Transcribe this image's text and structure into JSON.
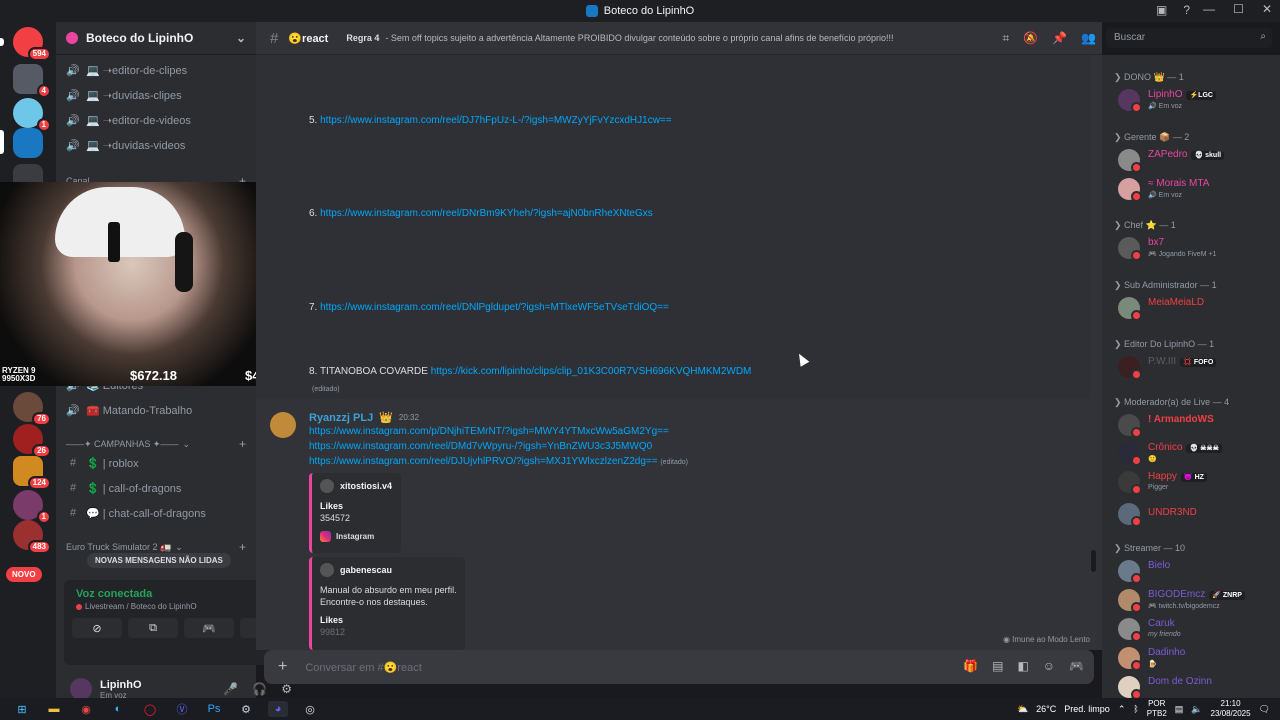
{
  "window": {
    "title": "Boteco do LipinhO",
    "minimize": "—",
    "maximize": "☐",
    "close": "✕"
  },
  "guilds": [
    {
      "badge": "594",
      "color": "#f23f43"
    },
    {
      "badge": "4",
      "color": "#555a64"
    },
    {
      "badge": "1",
      "color": "#6ec6e8"
    },
    {
      "badge": "",
      "color": "#1a78c2"
    },
    {
      "badge": "",
      "color": "#3a3c41"
    },
    {
      "badge": "76",
      "color": "#6a4a3a"
    },
    {
      "badge": "26",
      "color": "#a02020"
    },
    {
      "badge": "124",
      "color": "#d08a20"
    },
    {
      "badge": "1",
      "color": "#7a3a6a"
    },
    {
      "badge": "483",
      "color": "#9a3030"
    }
  ],
  "novo_label": "NOVO",
  "server": {
    "name": "Boteco do LipinhO"
  },
  "channels_top": [
    {
      "label": "💻 ➝editor-de-clipes"
    },
    {
      "label": "💻 ➝duvidas-clipes"
    },
    {
      "label": "💻 ➝editor-de-videos"
    },
    {
      "label": "💻 ➝duvidas-videos"
    }
  ],
  "category_canal": "Canal",
  "channels_mid": [
    {
      "label": "📚 Editores"
    },
    {
      "label": "🧰 Matando-Trabalho"
    }
  ],
  "category_campanhas": "——✦ CAMPANHAS ✦——",
  "channels_campanhas": [
    {
      "icon": "#",
      "label": "💲 | roblox"
    },
    {
      "icon": "#",
      "label": "💲 | call-of-dragons"
    },
    {
      "icon": "#",
      "label": "💬 | chat-call-of-dragons"
    }
  ],
  "category_euro": "Euro Truck Simulator 2 🚛",
  "unread_label": "NOVAS MENSAGENS NÃO LIDAS",
  "voice": {
    "status": "Voz conectada",
    "channel": "Livestream / Boteco do LipinhO"
  },
  "user": {
    "name": "LipinhO",
    "status": "Em voz"
  },
  "webcam": {
    "cpu": "RYZEN 9\n9950X3D",
    "price1": "$672.18",
    "price2": "$4,500"
  },
  "channel": {
    "name": "😮react",
    "topic_bold": "Regra 4",
    "topic": "- Sem off topics sujeito a advertência Altamente PROIBIDO divulgar conteúdo sobre o próprio canal afins de benefício próprio!!!"
  },
  "search": {
    "placeholder": "Buscar"
  },
  "messages": {
    "m5": {
      "num": "5.",
      "link": "https://www.instagram.com/reel/DJ7hFpUz-L-/?igsh=MWZyYjFvYzcxdHJ1cw=="
    },
    "m6": {
      "num": "6.",
      "link": "https://www.instagram.com/reel/DNrBm9KYheh/?igsh=ajN0bnRheXNteGxs"
    },
    "m7": {
      "num": "7.",
      "link": "https://www.instagram.com/reel/DNlPgldupet/?igsh=MTlxeWF5eTVseTdiOQ=="
    },
    "m8": {
      "text": "8. TITANOBOA COVARDE",
      "link": "https://kick.com/lipinho/clips/clip_01K3C00R7VSH696KVQHMKM2WDM"
    },
    "edited": "(editado)",
    "author": "Ryanzzj PLJ",
    "author_badge": "👑",
    "time": "20:32",
    "links": [
      "https://www.instagram.com/p/DNjhiTEMrNT/?igsh=MWY4YTMxcWw5aGM2Yg==",
      "https://www.instagram.com/reel/DMd7vWpyru-/?igsh=YnBnZWU3c3J5MWQ0",
      "https://www.instagram.com/reel/DJUjvhlPRVO/?igsh=MXJ1YWlxczlzenZ2dg=="
    ],
    "embed1": {
      "author": "xitostiosi.v4",
      "field": "Likes",
      "value": "354572",
      "footer": "Instagram"
    },
    "embed2": {
      "author": "gabenescau",
      "desc1": "Manual do absurdo em meu perfil.",
      "desc2": "Encontre-o nos destaques.",
      "field": "Likes",
      "value": "99812"
    },
    "slowmode": "Imune ao Modo Lento"
  },
  "composer": {
    "placeholder": "Conversar em #😮react"
  },
  "members": {
    "roles": [
      {
        "label": "❯ DONO 👑 — 1"
      },
      {
        "label": "❯ Gerente 📦 — 2"
      },
      {
        "label": "❯ Chef ⭐ — 1"
      },
      {
        "label": "❯ Sub Administrador — 1"
      },
      {
        "label": "❯ Editor Do LipinhO — 1"
      },
      {
        "label": "❯ Moderador(a) de Live — 4"
      },
      {
        "label": "❯ Streamer — 10"
      }
    ],
    "list": [
      {
        "name": "LipinhO",
        "tag": "⚡LGC",
        "act": "🔊 Em voz",
        "color": "#eb459e",
        "av": "#55375f"
      },
      {
        "name": "ZAPedro",
        "tag": "💀 skull",
        "act": "",
        "color": "#eb459e",
        "av": "#8a8a8a"
      },
      {
        "name": "≈ Morais MTA",
        "tag": "",
        "act": "🔊 Em voz",
        "color": "#eb459e",
        "av": "#d6a0a0"
      },
      {
        "name": "bx7",
        "tag": "",
        "act": "🎮 Jogando FiveM +1",
        "color": "#eb459e",
        "av": "#5a5a5a"
      },
      {
        "name": "MeiaMeiaLD",
        "tag": "",
        "act": "",
        "color": "#f23f43",
        "av": "#7a8a7a"
      },
      {
        "name": "P.W.III",
        "tag": "💢 FOFO",
        "act": "",
        "color": "#5c5e66",
        "av": "#3a2020"
      },
      {
        "name": "! ArmandoWS",
        "tag": "",
        "act": "",
        "color": "#f23f43",
        "av": "#4a4a4a"
      },
      {
        "name": "Crônico",
        "tag": "💀 ☠☠☠",
        "act": "🙂",
        "color": "#f23f43",
        "av": "#2a2a3a"
      },
      {
        "name": "Happy",
        "tag": "😈 HZ",
        "act": "Pigger",
        "color": "#f23f43",
        "av": "#3a3a3a"
      },
      {
        "name": "UNDR3ND",
        "tag": "",
        "act": "",
        "color": "#f23f43",
        "av": "#5a6a7a"
      },
      {
        "name": "Bielo",
        "tag": "",
        "act": "",
        "color": "#7b5cd6",
        "av": "#6a7a8a"
      },
      {
        "name": "BIGODEmcz",
        "tag": "🚀 ZNRP",
        "act": "🎮 twitch.tv/bigodemcz",
        "color": "#7b5cd6",
        "av": "#b08a6a"
      },
      {
        "name": "Caruk",
        "tag": "",
        "act": "my friendo",
        "color": "#7b5cd6",
        "av": "#8a8a8a"
      },
      {
        "name": "Dadinho",
        "tag": "",
        "act": "🍺",
        "color": "#7b5cd6",
        "av": "#c09070"
      },
      {
        "name": "Dom de Ozinn",
        "tag": "",
        "act": "",
        "color": "#7b5cd6",
        "av": "#e0d0c0"
      }
    ]
  },
  "taskbar": {
    "weather": "26°C",
    "weather_desc": "Pred. limpo",
    "lang1": "POR",
    "lang2": "PTB2",
    "time": "21:10",
    "date": "23/08/2025"
  }
}
